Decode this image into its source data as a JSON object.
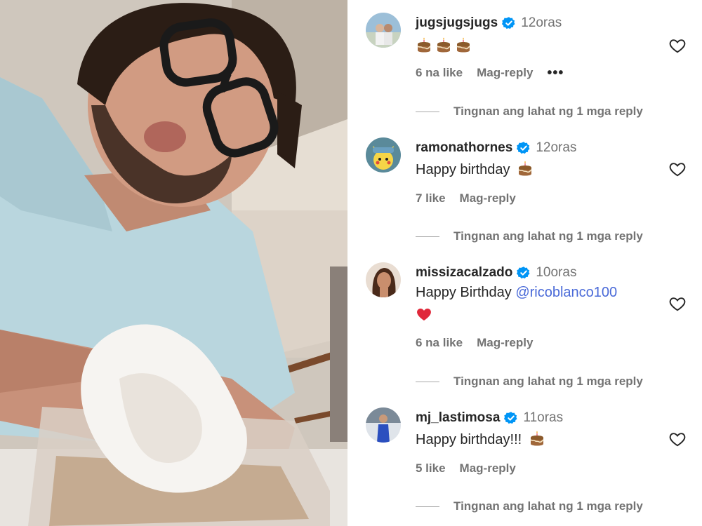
{
  "photo": {
    "alt_subject": "selfie-photo"
  },
  "comments": [
    {
      "username": "jugsjugsjugs",
      "time": "12oras",
      "text": "",
      "emojis": [
        "cake",
        "cake",
        "cake"
      ],
      "likes": "6 na like",
      "reply_label": "Mag-reply",
      "more_label": "•••",
      "view_replies": "Tingnan ang lahat ng 1 mga reply"
    },
    {
      "username": "ramonathornes",
      "time": "12oras",
      "text": "Happy birthday",
      "emojis": [
        "cake"
      ],
      "likes": "7 like",
      "reply_label": "Mag-reply",
      "view_replies": "Tingnan ang lahat ng 1 mga reply"
    },
    {
      "username": "missizacalzado",
      "time": "10oras",
      "text": "Happy Birthday",
      "mention": "@ricoblanco100",
      "emojis": [
        "heart"
      ],
      "likes": "6 na like",
      "reply_label": "Mag-reply",
      "view_replies": "Tingnan ang lahat ng 1 mga reply"
    },
    {
      "username": "mj_lastimosa",
      "time": "11oras",
      "text": "Happy birthday!!!",
      "emojis": [
        "cake"
      ],
      "likes": "5 like",
      "reply_label": "Mag-reply",
      "view_replies": "Tingnan ang lahat ng 1 mga reply"
    }
  ],
  "colors": {
    "verified": "#0095f6",
    "mention": "#4a6ad8",
    "muted": "#737373",
    "text": "#262626"
  }
}
